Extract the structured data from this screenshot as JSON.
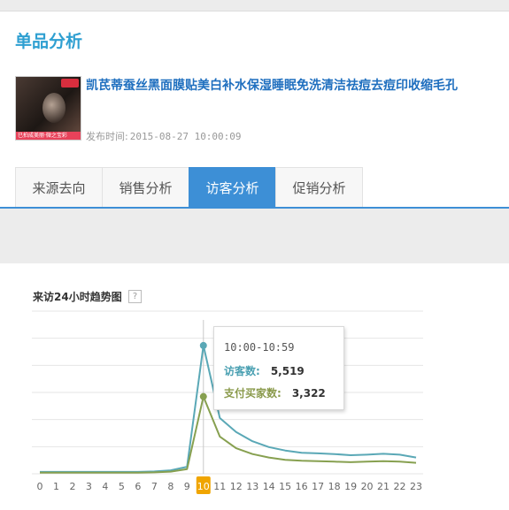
{
  "page": {
    "title": "单品分析"
  },
  "product": {
    "title": "凯芪蒂蚕丝黑面膜贴美白补水保湿睡眠免洗清洁祛痘去痘印收缩毛孔",
    "publish_label": "发布时间:",
    "publish_time": "2015-08-27 10:00:09",
    "thumb_strip_text": "已拍成美丽·微之宝彩"
  },
  "tabs": [
    {
      "label": "来源去向",
      "active": false
    },
    {
      "label": "销售分析",
      "active": false
    },
    {
      "label": "访客分析",
      "active": true
    },
    {
      "label": "促销分析",
      "active": false
    }
  ],
  "chart_section": {
    "title": "来访24小时趋势图",
    "help": "?"
  },
  "chart_data": {
    "type": "line",
    "title": "来访24小时趋势图",
    "x": [
      0,
      1,
      2,
      3,
      4,
      5,
      6,
      7,
      8,
      9,
      10,
      11,
      12,
      13,
      14,
      15,
      16,
      17,
      18,
      19,
      20,
      21,
      22,
      23
    ],
    "highlight_x": 10,
    "series": [
      {
        "name": "访客数",
        "color": "#5aa8b6",
        "values": [
          80,
          80,
          80,
          80,
          80,
          80,
          80,
          100,
          150,
          300,
          5519,
          2400,
          1800,
          1400,
          1150,
          1000,
          900,
          880,
          850,
          800,
          820,
          860,
          820,
          700
        ]
      },
      {
        "name": "支付买家数",
        "color": "#87a050",
        "values": [
          50,
          50,
          50,
          50,
          50,
          50,
          50,
          60,
          90,
          200,
          3322,
          1600,
          1100,
          850,
          700,
          600,
          560,
          540,
          520,
          500,
          520,
          540,
          520,
          470
        ]
      }
    ],
    "ylim": [
      0,
      7000
    ],
    "grid": true,
    "legend": "none"
  },
  "tooltip": {
    "time": "10:00-10:59",
    "visitors_label": "访客数:",
    "visitors_value": "5,519",
    "buyers_label": "支付买家数:",
    "buyers_value": "3,322"
  },
  "colors": {
    "accent": "#3d8fd6",
    "title": "#2e9fd1",
    "link": "#1f6fbf",
    "highlight": "#f0a500"
  }
}
